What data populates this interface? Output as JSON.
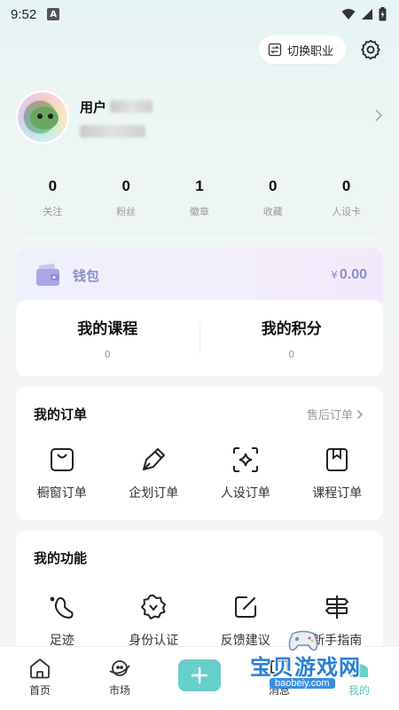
{
  "status_bar": {
    "time": "9:52",
    "notif_letter": "A"
  },
  "header": {
    "switch_role_label": "切换职业"
  },
  "profile": {
    "username_prefix": "用户"
  },
  "stats": [
    {
      "value": "0",
      "label": "关注"
    },
    {
      "value": "0",
      "label": "粉丝"
    },
    {
      "value": "1",
      "label": "徽章"
    },
    {
      "value": "0",
      "label": "收藏"
    },
    {
      "value": "0",
      "label": "人设卡"
    }
  ],
  "wallet": {
    "label": "钱包",
    "currency": "¥",
    "amount": "0.00"
  },
  "course_points": {
    "courses_label": "我的课程",
    "courses_value": "0",
    "points_label": "我的积分",
    "points_value": "0"
  },
  "orders": {
    "title": "我的订单",
    "after_sale_label": "售后订单",
    "items": [
      {
        "label": "橱窗订单",
        "icon": "shopping-bag-icon"
      },
      {
        "label": "企划订单",
        "icon": "pen-nib-icon"
      },
      {
        "label": "人设订单",
        "icon": "sparkle-scan-icon"
      },
      {
        "label": "课程订单",
        "icon": "bookmark-book-icon"
      }
    ]
  },
  "functions": {
    "title": "我的功能",
    "items": [
      {
        "label": "足迹",
        "icon": "footprint-icon"
      },
      {
        "label": "身份认证",
        "icon": "verified-badge-icon"
      },
      {
        "label": "反馈建议",
        "icon": "edit-square-icon"
      },
      {
        "label": "新手指南",
        "icon": "signpost-icon"
      }
    ]
  },
  "bottom_nav": [
    {
      "label": "首页",
      "icon": "home-icon"
    },
    {
      "label": "市场",
      "icon": "planet-icon"
    },
    {
      "label": "",
      "icon": "add-icon"
    },
    {
      "label": "消息",
      "icon": "message-icon"
    },
    {
      "label": "我的",
      "icon": "profile-icon"
    }
  ],
  "watermark": {
    "title": "宝贝游戏网",
    "url": "baobeiy.com"
  },
  "colors": {
    "accent": "#67cfc9",
    "wallet": "#8b8ec9",
    "muted": "#999999"
  }
}
